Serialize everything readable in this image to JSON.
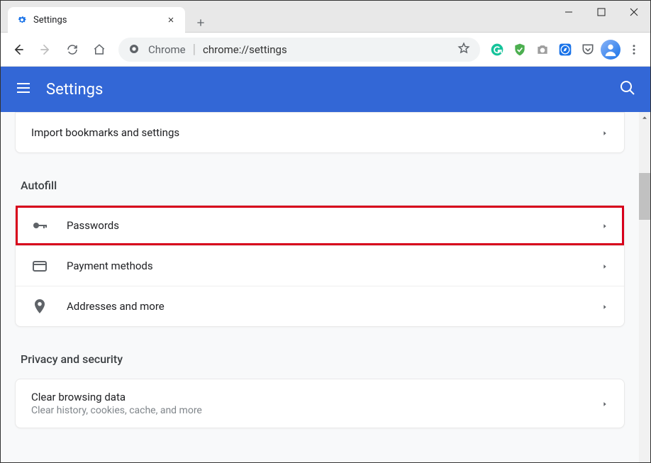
{
  "window": {
    "tab": {
      "title": "Settings"
    }
  },
  "toolbar": {
    "chrome_label": "Chrome",
    "url": "chrome://settings"
  },
  "header": {
    "title": "Settings"
  },
  "sections": {
    "import": {
      "label": "Import bookmarks and settings"
    },
    "autofill": {
      "title": "Autofill",
      "passwords": "Passwords",
      "payment": "Payment methods",
      "addresses": "Addresses and more"
    },
    "privacy": {
      "title": "Privacy and security",
      "clear_title": "Clear browsing data",
      "clear_sub": "Clear history, cookies, cache, and more"
    }
  }
}
